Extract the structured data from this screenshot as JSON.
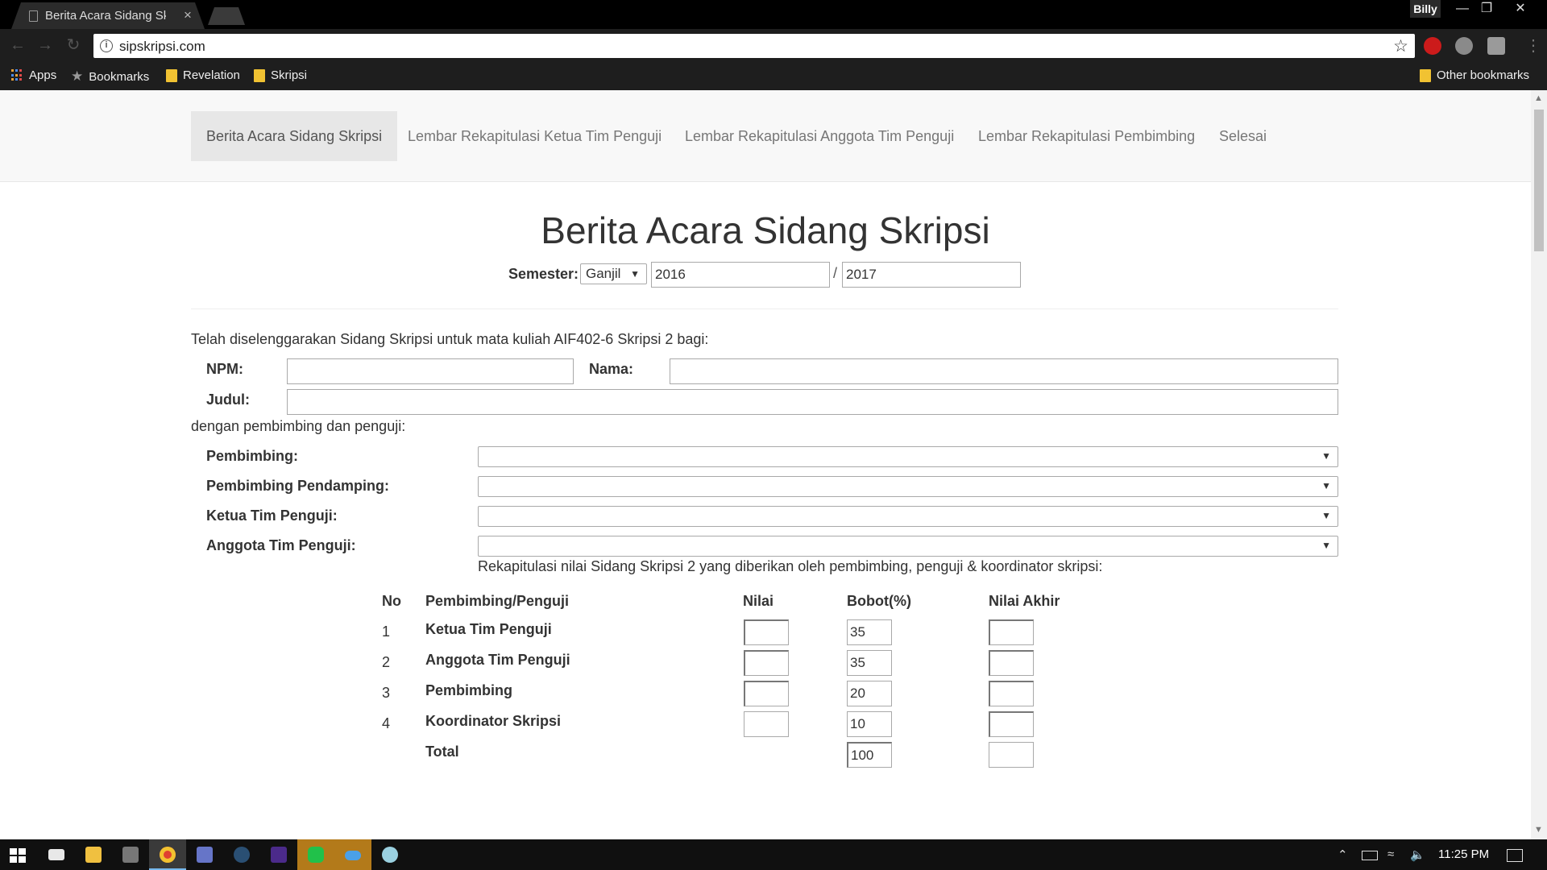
{
  "browser": {
    "tab_title": "Berita Acara Sidang Skripsi",
    "tab_close": "×",
    "user_name": "Billy",
    "url": "sipskripsi.com",
    "win_minimize": "—",
    "win_restore": "❐",
    "win_close": "✕",
    "bookmarks": {
      "apps": "Apps",
      "bookmarks": "Bookmarks",
      "revelation": "Revelation",
      "skripsi": "Skripsi",
      "other": "Other bookmarks"
    }
  },
  "navbar": {
    "items": [
      "Berita Acara Sidang Skripsi",
      "Lembar Rekapitulasi Ketua Tim Penguji",
      "Lembar Rekapitulasi Anggota Tim Penguji",
      "Lembar Rekapitulasi Pembimbing",
      "Selesai"
    ]
  },
  "form": {
    "title": "Berita Acara Sidang Skripsi",
    "semester_label": "Semester:",
    "semester_value": "Ganjil",
    "year_start": "2016",
    "year_separator": "/",
    "year_end": "2017",
    "intro_text": "Telah diselenggarakan Sidang Skripsi untuk mata kuliah AIF402-6 Skripsi 2 bagi:",
    "npm_label": "NPM:",
    "npm_value": "",
    "nama_label": "Nama:",
    "nama_value": "",
    "judul_label": "Judul:",
    "judul_value": "",
    "pembimbing_text": "dengan pembimbing dan penguji:",
    "pembimbing_label": "Pembimbing:",
    "pendamping_label": "Pembimbing Pendamping:",
    "ketua_label": "Ketua Tim Penguji:",
    "anggota_label": "Anggota Tim Penguji:",
    "rekap_text": "Rekapitulasi nilai Sidang Skripsi 2 yang diberikan oleh pembimbing, penguji & koordinator skripsi:"
  },
  "table": {
    "headers": [
      "No",
      "Pembimbing/Penguji",
      "Nilai",
      "Bobot(%)",
      "Nilai Akhir"
    ],
    "rows": [
      {
        "no": "1",
        "role": "Ketua Tim Penguji",
        "nilai": "",
        "bobot": "35",
        "akhir": ""
      },
      {
        "no": "2",
        "role": "Anggota Tim Penguji",
        "nilai": "",
        "bobot": "35",
        "akhir": ""
      },
      {
        "no": "3",
        "role": "Pembimbing",
        "nilai": "",
        "bobot": "20",
        "akhir": ""
      },
      {
        "no": "4",
        "role": "Koordinator Skripsi",
        "nilai": "",
        "bobot": "10",
        "akhir": ""
      }
    ],
    "total_label": "Total",
    "total_bobot": "100",
    "total_akhir": ""
  },
  "taskbar": {
    "clock": "11:25 PM"
  },
  "icons": [
    "page-icon",
    "back-icon",
    "forward-icon",
    "reload-icon",
    "info-icon",
    "star-icon",
    "opera-icon",
    "globe-icon",
    "extension-icon",
    "menu-icon",
    "apps-icon",
    "folder-icon",
    "windows-start-icon",
    "mail-icon",
    "file-explorer-icon",
    "chrome-icon",
    "discord-icon",
    "steam-icon",
    "line-icon",
    "onedrive-icon",
    "notification-icon"
  ],
  "colors": {
    "navbar_bg": "#f8f8f8",
    "nav_active_bg": "#e7e7e7",
    "text": "#333333",
    "chrome_bg": "#1e1e1e"
  }
}
